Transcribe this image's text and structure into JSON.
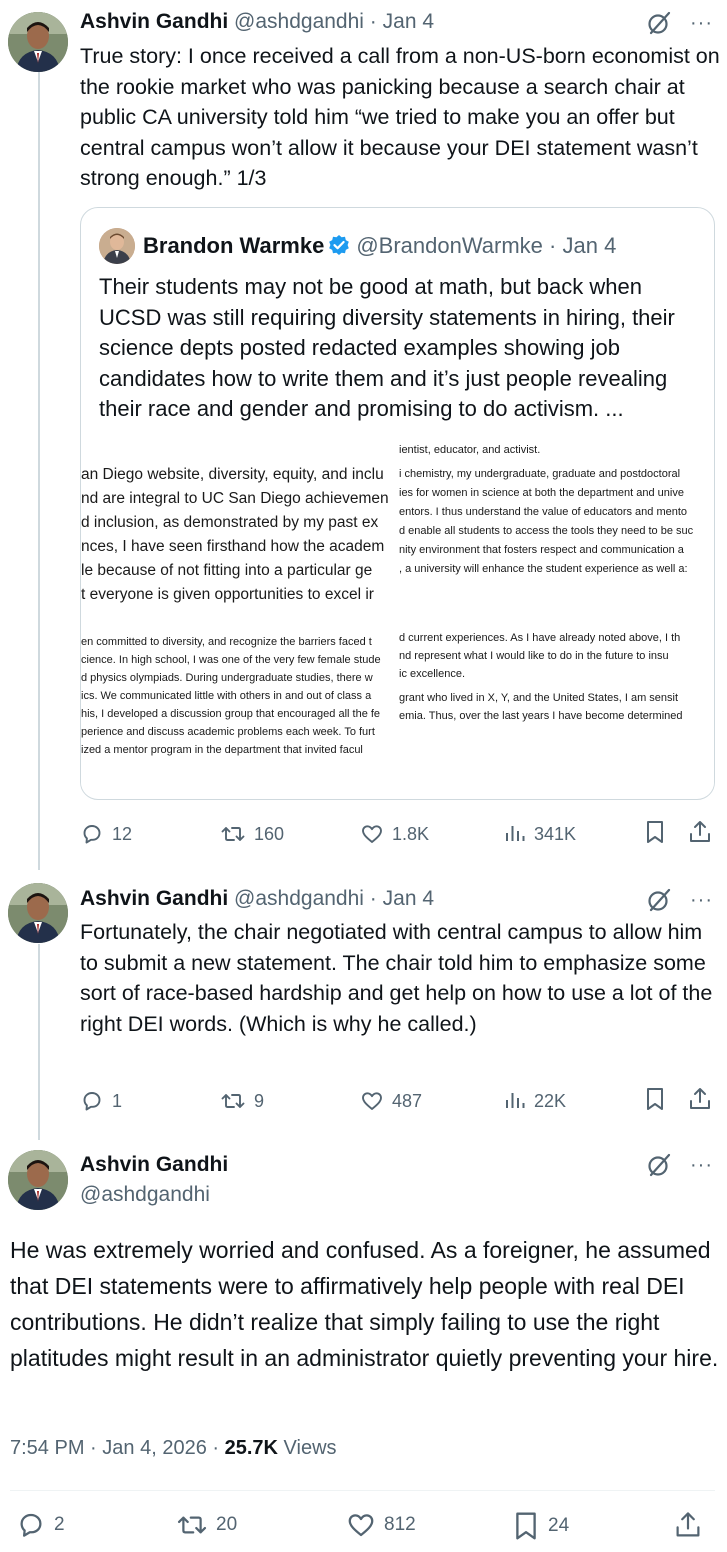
{
  "tweets": [
    {
      "name": "Ashvin Gandhi",
      "handle": "@ashdgandhi",
      "dot": "·",
      "date": "Jan 4",
      "text": "True story: I once received a call from a non-US-born economist on the rookie market who was panicking because a search chair at public CA university told him “we tried to make you an offer but central campus won’t allow it because your DEI statement wasn’t strong enough.” 1/3",
      "quote": {
        "name": "Brandon Warmke",
        "handle": "@BrandonWarmke",
        "dot": "·",
        "date": "Jan 4",
        "text": "Their students may not be good at math, but back when UCSD was still requiring diversity statements in hiring, their science depts posted redacted examples showing job candidates how to write them and it’s just people revealing their race and gender and promising to do activism.  ...",
        "image_lines_left": [
          "an Diego website, diversity, equity, and inclu",
          "nd are integral to UC San Diego achievemen",
          "d inclusion, as demonstrated by my past ex",
          "nces, I have seen firsthand how the academ",
          "le because of not fitting into a particular ge",
          "t everyone is given opportunities to excel ir",
          "en committed to diversity, and recognize the barriers faced t",
          "cience. In high school, I was one of the very few female stude",
          "d physics olympiads. During undergraduate studies, there w",
          "ics. We communicated little with others in and out of class a",
          "his, I developed a discussion group that encouraged all the fe",
          "perience and discuss academic problems each week. To furt",
          "ized a mentor program in the department that invited facul"
        ],
        "image_lines_right": [
          "ientist, educator, and activist.",
          "i chemistry, my undergraduate, graduate and postdoctoral",
          "ies for women in science at both the department and unive",
          "entors. I thus understand the value of educators and mento",
          "d enable all students to access the tools they need to be suc",
          "nity environment that fosters respect and communication a",
          ", a university will enhance the student experience as well a:",
          "d current experiences. As I have already noted above, I th",
          "nd represent what I would like to do in the future to insu",
          "ic excellence.",
          "grant who lived in X, Y, and the United States, I am sensit",
          "emia. Thus, over the last years I have become determined"
        ]
      },
      "stats": {
        "replies": "12",
        "reposts": "160",
        "likes": "1.8K",
        "views": "341K"
      }
    },
    {
      "name": "Ashvin Gandhi",
      "handle": "@ashdgandhi",
      "dot": "·",
      "date": "Jan 4",
      "text": "Fortunately, the chair negotiated with central campus to allow him to submit a new statement. The chair told him to emphasize some sort of race-based hardship and get help on how to use a lot of the right DEI words. (Which is why he called.)",
      "stats": {
        "replies": "1",
        "reposts": "9",
        "likes": "487",
        "views": "22K"
      }
    }
  ],
  "focus": {
    "name": "Ashvin Gandhi",
    "handle": "@ashdgandhi",
    "text": "He was extremely worried and confused. As a foreigner, he assumed that DEI statements were to affirmatively help people with real DEI contributions. He didn’t realize that simply failing to use the right platitudes might result in an administrator quietly preventing your hire.",
    "time": "7:54 PM",
    "dot": "·",
    "date": "Jan 4, 2026",
    "dot2": "·",
    "views_count": "25.7K",
    "views_label": "Views",
    "stats": {
      "replies": "2",
      "reposts": "20",
      "likes": "812",
      "bookmarks": "24"
    }
  },
  "more_glyph": "···",
  "colors": {
    "text": "#0f1419",
    "secondary": "#536471",
    "line": "#cfd9de",
    "verified": "#1d9bf0"
  },
  "icons": [
    "grok-icon",
    "more-icon",
    "reply-icon",
    "repost-icon",
    "like-icon",
    "views-icon",
    "bookmark-icon",
    "share-icon",
    "verified-badge-icon"
  ]
}
